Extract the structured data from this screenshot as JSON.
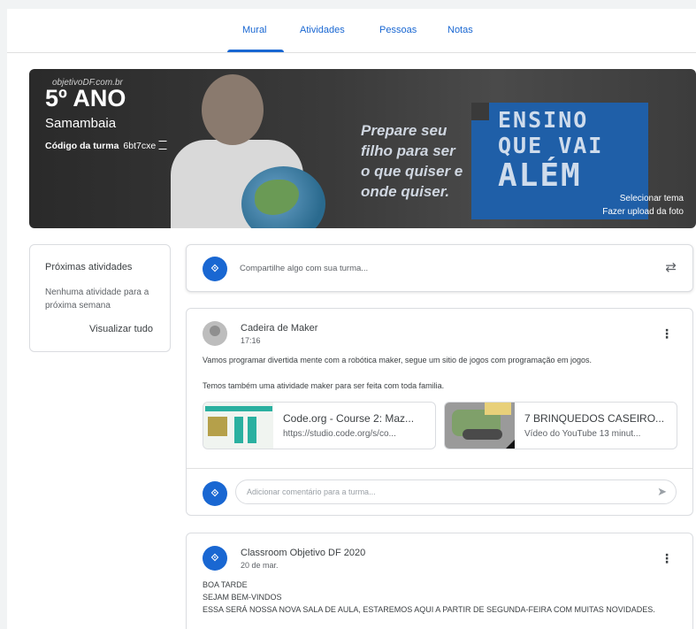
{
  "tabs": [
    {
      "label": "Mural",
      "active": true
    },
    {
      "label": "Atividades",
      "active": false
    },
    {
      "label": "Pessoas",
      "active": false
    },
    {
      "label": "Notas",
      "active": false
    }
  ],
  "banner": {
    "watermark": "objetivoDF.com.br",
    "class_name": "5º ANO",
    "section": "Samambaia",
    "code_label": "Código da turma",
    "code_value": "6bt7cxe",
    "slogan": [
      "Prepare seu",
      "filho para ser",
      "o que quiser e",
      "onde quiser."
    ],
    "brand_lines": [
      "ENSINO",
      "QUE VAI",
      "ALÉM"
    ],
    "select_theme": "Selecionar tema",
    "upload_photo": "Fazer upload da foto"
  },
  "upcoming": {
    "title": "Próximas atividades",
    "empty_text": "Nenhuma atividade para a próxima semana",
    "view_all": "Visualizar tudo"
  },
  "share": {
    "avatar_text": "⟐",
    "placeholder": "Compartilhe algo com sua turma..."
  },
  "posts": [
    {
      "author": "Cadeira de Maker",
      "time": "17:16",
      "lines": [
        "Vamos programar divertida mente com a robótica maker, segue um sitio de jogos com programação em jogos.",
        "Temos também uma atividade maker para ser feita com toda familia."
      ],
      "attachments": [
        {
          "title": "Code.org - Course 2: Maz...",
          "subtitle": "https://studio.code.org/s/co..."
        },
        {
          "title": "7 BRINQUEDOS CASEIRO...",
          "subtitle": "Vídeo do YouTube   13 minut..."
        }
      ],
      "comment_placeholder": "Adicionar comentário para a turma..."
    },
    {
      "author": "Classroom Objetivo DF 2020",
      "time": "20 de mar.",
      "lines": [
        "BOA TARDE",
        "SEJAM BEM-VINDOS",
        "ESSA SERÁ NOSSA NOVA SALA DE AULA, ESTAREMOS AQUI A PARTIR DE SEGUNDA-FEIRA COM MUITAS NOVIDADES."
      ]
    }
  ],
  "colors": {
    "accent": "#1967d2",
    "text": "#3c4043",
    "muted": "#5f6368",
    "border": "#dadce0"
  }
}
